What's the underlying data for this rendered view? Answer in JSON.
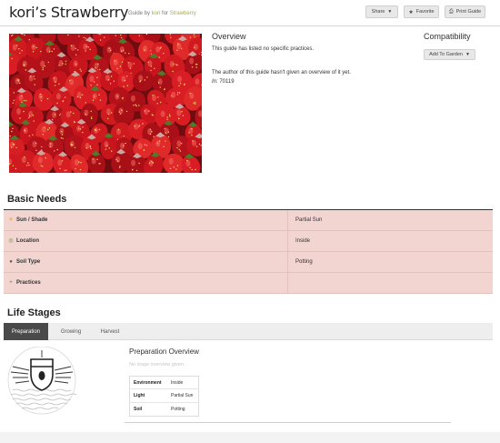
{
  "header": {
    "title": "kori’s Strawberry",
    "guide_by": "Guide by",
    "author": "kori",
    "for_word": "for",
    "plant": "Strawberry",
    "share_label": "Share",
    "favorite_label": "Favorite",
    "print_label": "Print Guide"
  },
  "overview": {
    "title": "Overview",
    "practices_text": "This guide has listed no specific practices.",
    "author_text": "The author of this guide hasn't given an overview of it yet.",
    "in_label": "In:",
    "in_value": "70119"
  },
  "compatibility": {
    "title": "Compatibility",
    "add_to_garden_label": "Add To Garden"
  },
  "basic_needs": {
    "title": "Basic Needs",
    "rows": [
      {
        "label": "Sun / Shade",
        "value": "Partial Sun",
        "icon": "sun-icon",
        "icon_glyph": "☀",
        "icon_color": "#e8a317"
      },
      {
        "label": "Location",
        "value": "Inside",
        "icon": "location-icon",
        "icon_glyph": "◎",
        "icon_color": "#7a8a3a"
      },
      {
        "label": "Soil Type",
        "value": "Potting",
        "icon": "soil-icon",
        "icon_glyph": "●",
        "icon_color": "#8b4a2b"
      },
      {
        "label": "Practices",
        "value": "",
        "icon": "practices-icon",
        "icon_glyph": "+",
        "icon_color": "#b05a4a"
      }
    ]
  },
  "life_stages": {
    "title": "Life Stages",
    "tabs": [
      "Preparation",
      "Growing",
      "Harvest"
    ],
    "active_tab": "Preparation",
    "stage_title": "Preparation Overview",
    "stage_subtitle": "No stage overview given.",
    "table": [
      {
        "label": "Environment",
        "value": "Inside"
      },
      {
        "label": "Light",
        "value": "Partial Sun"
      },
      {
        "label": "Soil",
        "value": "Potting"
      }
    ]
  },
  "colors": {
    "needs_row_bg": "#f2d4d0",
    "active_tab_bg": "#4a4a4a",
    "link_color": "#a9ad4a"
  }
}
